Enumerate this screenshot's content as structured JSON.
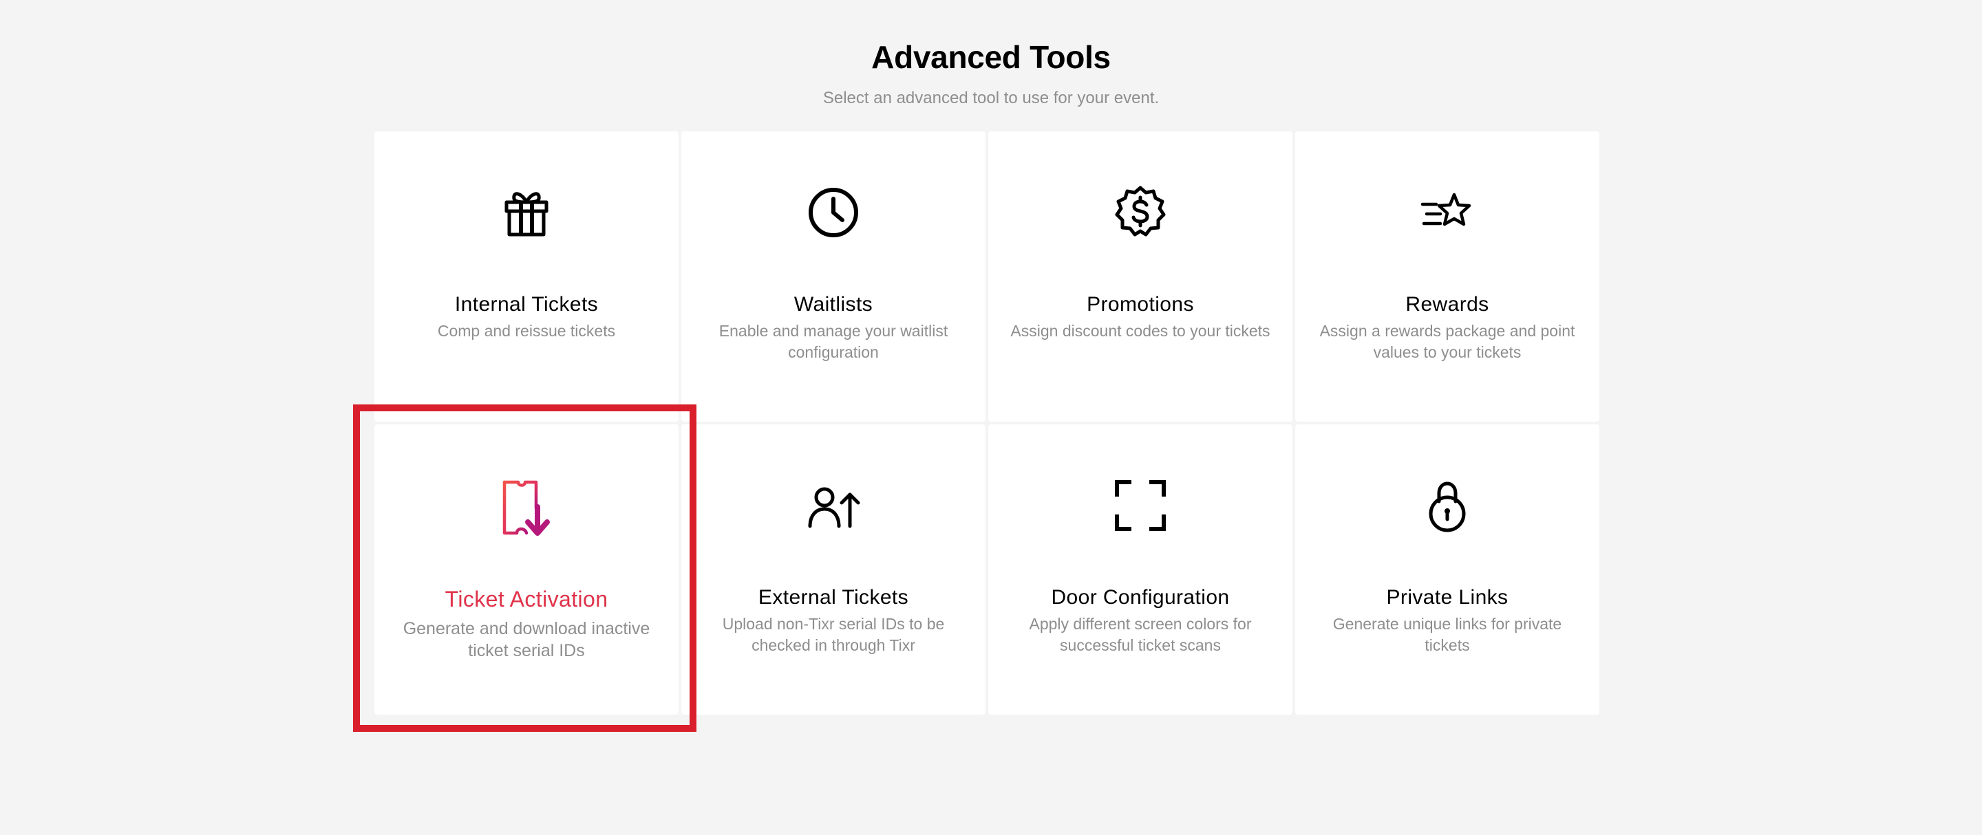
{
  "header": {
    "title": "Advanced Tools",
    "subtitle": "Select an advanced tool to use for your event."
  },
  "accent_color": "#e0324a",
  "highlight_color": "#d91f2b",
  "tools": [
    {
      "icon": "gift-icon",
      "title": "Internal Tickets",
      "description": "Comp and reissue tickets"
    },
    {
      "icon": "clock-icon",
      "title": "Waitlists",
      "description": "Enable and manage your waitlist configuration"
    },
    {
      "icon": "dollar-badge-icon",
      "title": "Promotions",
      "description": "Assign discount codes to your tickets"
    },
    {
      "icon": "star-speed-icon",
      "title": "Rewards",
      "description": "Assign a rewards package and point values to your tickets"
    },
    {
      "icon": "ticket-download-icon",
      "title": "Ticket Activation",
      "description": "Generate and download inactive ticket serial IDs",
      "selected": true
    },
    {
      "icon": "user-upload-icon",
      "title": "External Tickets",
      "description": "Upload non-Tixr serial IDs to be checked in through Tixr"
    },
    {
      "icon": "scan-frame-icon",
      "title": "Door Configuration",
      "description": "Apply different screen colors for successful ticket scans"
    },
    {
      "icon": "padlock-icon",
      "title": "Private Links",
      "description": "Generate unique links for private tickets"
    }
  ]
}
